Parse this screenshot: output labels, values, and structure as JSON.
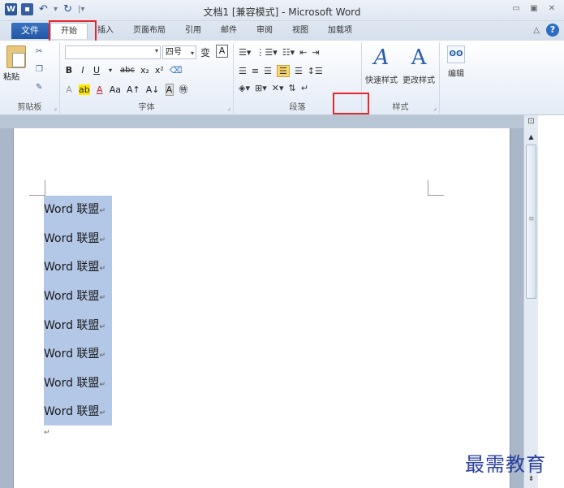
{
  "titlebar": {
    "title": "文档1 [兼容模式] - Microsoft Word",
    "logo_letter": "W"
  },
  "tabs": {
    "file": "文件",
    "items": [
      "开始",
      "插入",
      "页面布局",
      "引用",
      "邮件",
      "审阅",
      "视图",
      "加载项"
    ],
    "active": "开始"
  },
  "ribbon": {
    "clipboard": {
      "label": "剪贴板",
      "paste": "粘贴"
    },
    "font": {
      "label": "字体",
      "font_name": "",
      "size": "四号",
      "change_case_char": "变",
      "border_char": "A"
    },
    "paragraph": {
      "label": "段落"
    },
    "styles": {
      "label": "样式",
      "quick_styles": "快速样式",
      "change_styles": "更改样式"
    },
    "editing": {
      "label": "编辑"
    }
  },
  "document": {
    "lines": [
      "Word 联盟",
      "Word 联盟",
      "Word 联盟",
      "Word 联盟",
      "Word 联盟",
      "Word 联盟",
      "Word 联盟",
      "Word 联盟"
    ]
  },
  "watermark": "最需教育",
  "colors": {
    "highlight_red": "#e5262a",
    "file_tab": "#2456a6",
    "selection": "#b3c7e6"
  }
}
